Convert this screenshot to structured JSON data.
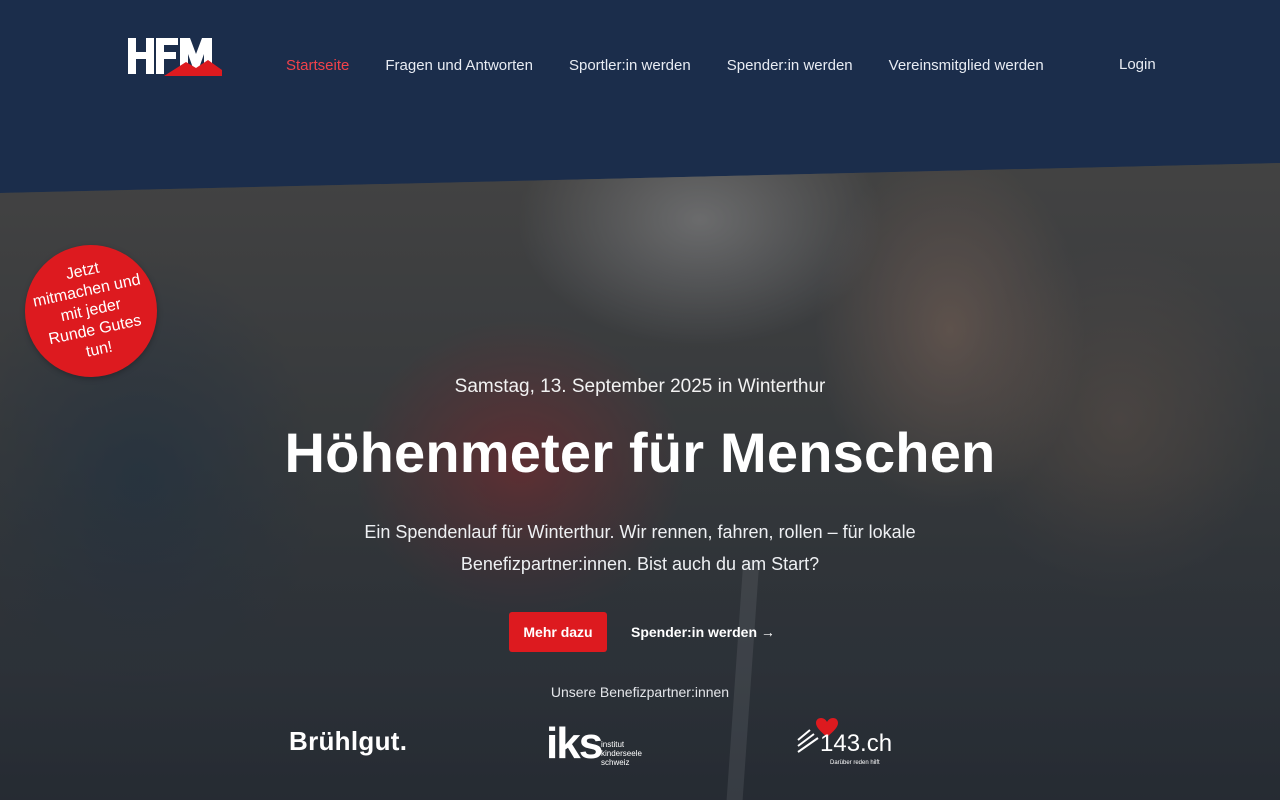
{
  "header": {
    "logo_alt": "HFM",
    "nav": [
      {
        "label": "Startseite",
        "active": true
      },
      {
        "label": "Fragen und Antworten",
        "active": false
      },
      {
        "label": "Sportler:in werden",
        "active": false
      },
      {
        "label": "Spender:in werden",
        "active": false
      },
      {
        "label": "Vereinsmitglied werden",
        "active": false
      }
    ],
    "login_label": "Login"
  },
  "badge": {
    "text": "Jetzt mitmachen und mit jeder Runde Gutes tun!"
  },
  "hero": {
    "date": "Samstag, 13. September 2025 in Winterthur",
    "title": "Höhenmeter für Menschen",
    "lead": "Ein Spendenlauf für Winterthur. Wir rennen, fahren, rollen – für lokale Benefizpartner:innen. Bist auch du am Start?",
    "primary_button": "Mehr dazu",
    "secondary_link": "Spender:in werden →"
  },
  "partners": {
    "title": "Unsere Benefizpartner:innen",
    "items": [
      {
        "name": "Brühlgut."
      },
      {
        "name": "iks",
        "subtitle": "institut kinderseele schweiz"
      },
      {
        "name": "143.ch",
        "tagline": "Darüber reden hilft"
      }
    ]
  },
  "colors": {
    "navy": "#1b2d4b",
    "accent": "#dd1a1f",
    "nav_active": "#f2424a"
  }
}
